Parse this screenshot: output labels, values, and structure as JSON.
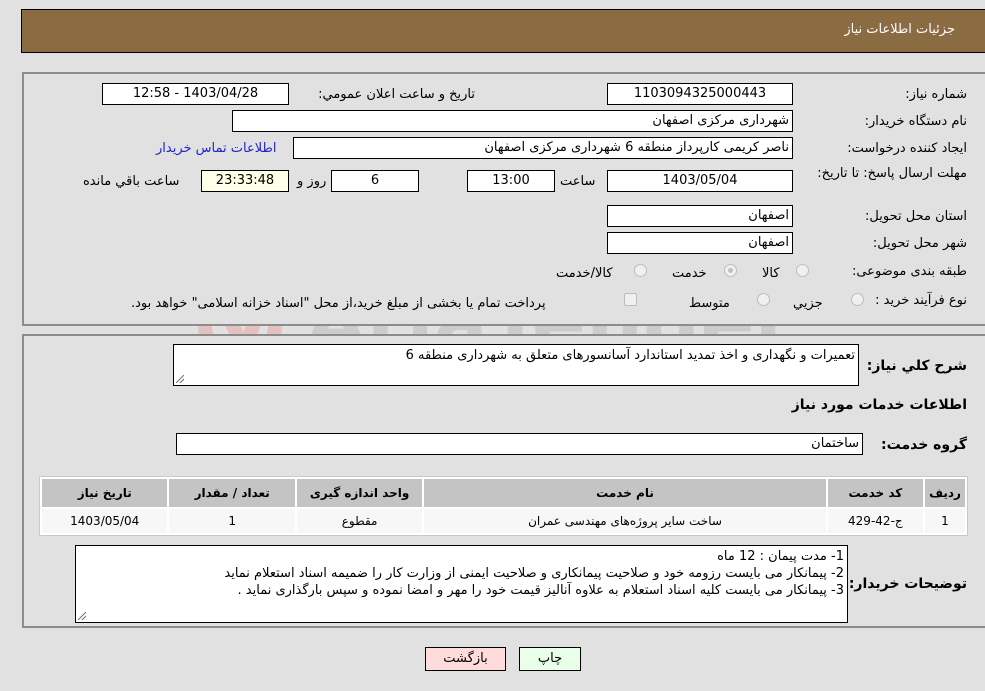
{
  "header": {
    "title": "جزئیات اطلاعات نیاز"
  },
  "form": {
    "need_number": {
      "label": "شماره نیاز:",
      "value": "1103094325000443"
    },
    "announce_datetime": {
      "label": "تاریخ و ساعت اعلان عمومي:",
      "value": "1403/04/28 - 12:58"
    },
    "buyer_org": {
      "label": "نام دستگاه خریدار:",
      "value": "شهرداری مرکزی اصفهان"
    },
    "requester": {
      "label": "ایجاد کننده درخواست:",
      "value": "ناصر کریمی کارپرداز منطقه 6 شهرداری مرکزی اصفهان"
    },
    "buyer_contact_link": "اطلاعات تماس خریدار",
    "deadline": {
      "label": "مهلت ارسال پاسخ: تا تاریخ:",
      "date": "1403/05/04",
      "time_label": "ساعت",
      "time": "13:00",
      "days": "6",
      "days_label": "روز و",
      "remaining": "23:33:48",
      "remaining_label": "ساعت باقي مانده"
    },
    "province": {
      "label": "استان محل تحویل:",
      "value": "اصفهان"
    },
    "city": {
      "label": "شهر محل تحویل:",
      "value": "اصفهان"
    },
    "category": {
      "label": "طبقه بندی موضوعی:",
      "options": [
        "کالا",
        "خدمت",
        "کالا/خدمت"
      ],
      "selected": "خدمت"
    },
    "purchase_type": {
      "label": "نوع فرآیند خرید :",
      "options": [
        "جزيي",
        "متوسط"
      ],
      "checkbox_text": "پرداخت تمام یا بخشی از مبلغ خرید،از محل \"اسناد خزانه اسلامی\" خواهد بود."
    }
  },
  "details": {
    "description_label": "شرح کلي نیاز:",
    "description": "تعمیرات و نگهداری و اخذ تمدید استاندارد آسانسورهای متعلق به شهرداری منطقه 6",
    "services_title": "اطلاعات خدمات مورد نیاز",
    "service_group_label": "گروه خدمت:",
    "service_group": "ساختمان",
    "table": {
      "headers": [
        "ردیف",
        "کد خدمت",
        "نام خدمت",
        "واحد اندازه گیری",
        "تعداد / مقدار",
        "تاریخ نیاز"
      ],
      "rows": [
        [
          "1",
          "ج-42-429",
          "ساخت سایر پروژه‌های مهندسی عمران",
          "مقطوع",
          "1",
          "1403/05/04"
        ]
      ]
    },
    "buyer_notes_label": "توضیحات خریدار:",
    "buyer_notes": [
      "1- مدت پیمان : 12 ماه",
      "2- پیمانکار می بایست رزومه خود و صلاحیت پیمانکاری و صلاحیت ایمنی از وزارت کار را ضمیمه اسناد استعلام نماید",
      "3- پیمانکار می بایست کلیه اسناد استعلام به علاوه آنالیز قیمت خود را مهر و امضا نموده و سپس بارگذاری نماید ."
    ]
  },
  "buttons": {
    "print": "چاپ",
    "back": "بازگشت"
  },
  "watermark": {
    "text": "AriaTender.neT"
  }
}
